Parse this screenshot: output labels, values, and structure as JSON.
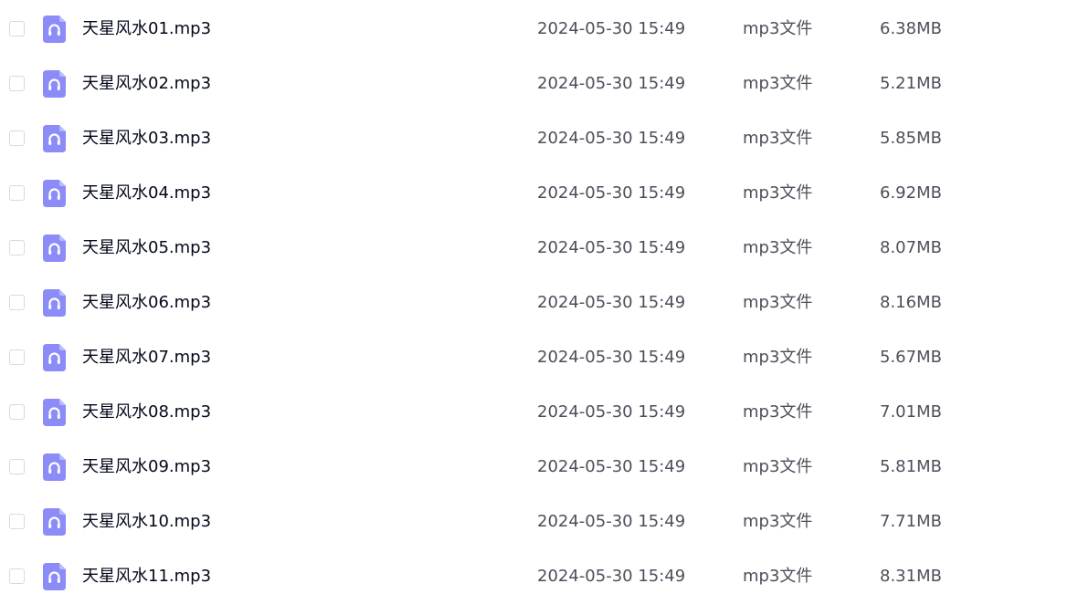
{
  "files": [
    {
      "name": "天星风水01.mp3",
      "modified": "2024-05-30 15:49",
      "type": "mp3文件",
      "size": "6.38MB"
    },
    {
      "name": "天星风水02.mp3",
      "modified": "2024-05-30 15:49",
      "type": "mp3文件",
      "size": "5.21MB"
    },
    {
      "name": "天星风水03.mp3",
      "modified": "2024-05-30 15:49",
      "type": "mp3文件",
      "size": "5.85MB"
    },
    {
      "name": "天星风水04.mp3",
      "modified": "2024-05-30 15:49",
      "type": "mp3文件",
      "size": "6.92MB"
    },
    {
      "name": "天星风水05.mp3",
      "modified": "2024-05-30 15:49",
      "type": "mp3文件",
      "size": "8.07MB"
    },
    {
      "name": "天星风水06.mp3",
      "modified": "2024-05-30 15:49",
      "type": "mp3文件",
      "size": "8.16MB"
    },
    {
      "name": "天星风水07.mp3",
      "modified": "2024-05-30 15:49",
      "type": "mp3文件",
      "size": "5.67MB"
    },
    {
      "name": "天星风水08.mp3",
      "modified": "2024-05-30 15:49",
      "type": "mp3文件",
      "size": "7.01MB"
    },
    {
      "name": "天星风水09.mp3",
      "modified": "2024-05-30 15:49",
      "type": "mp3文件",
      "size": "5.81MB"
    },
    {
      "name": "天星风水10.mp3",
      "modified": "2024-05-30 15:49",
      "type": "mp3文件",
      "size": "7.71MB"
    },
    {
      "name": "天星风水11.mp3",
      "modified": "2024-05-30 15:49",
      "type": "mp3文件",
      "size": "8.31MB"
    }
  ],
  "icon": {
    "name": "audio-file-icon",
    "color": "#8b8cf7"
  }
}
